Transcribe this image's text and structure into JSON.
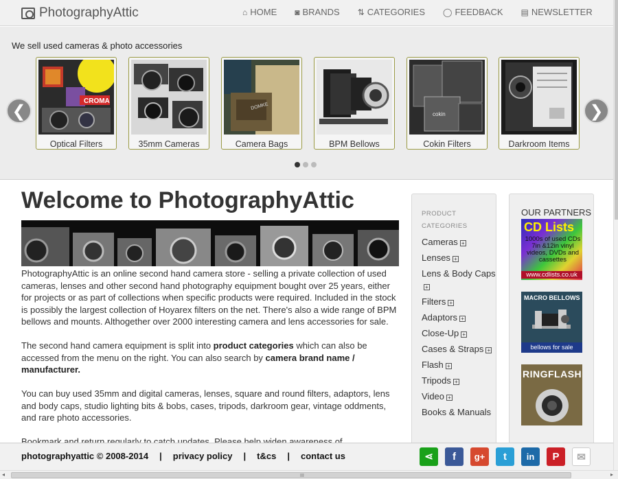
{
  "header": {
    "brand": "PhotographyAttic",
    "nav": [
      {
        "label": "HOME",
        "icon": "home-icon",
        "glyph": "⌂"
      },
      {
        "label": "BRANDS",
        "icon": "camera-icon",
        "glyph": "◙"
      },
      {
        "label": "CATEGORIES",
        "icon": "sort-icon",
        "glyph": "⇅"
      },
      {
        "label": "FEEDBACK",
        "icon": "speech-bubble-icon",
        "glyph": "◯"
      },
      {
        "label": "NEWSLETTER",
        "icon": "newspaper-icon",
        "glyph": "▤"
      }
    ]
  },
  "carousel": {
    "tagline": "We sell used cameras & photo accessories",
    "items": [
      {
        "label": "Optical Filters"
      },
      {
        "label": "35mm Cameras"
      },
      {
        "label": "Camera Bags"
      },
      {
        "label": "BPM Bellows"
      },
      {
        "label": "Cokin Filters"
      },
      {
        "label": "Darkroom Items"
      }
    ],
    "prev_glyph": "❮",
    "next_glyph": "❯",
    "active_slide": 1,
    "slide_count": 3
  },
  "main": {
    "title": "Welcome to PhotographyAttic",
    "p1": "PhotographyAttic is an online second hand camera store - selling a private collection of used cameras, lenses and other second hand photography equipment bought over 25 years, either for projects or as part of collections when specific products were required. Included in the stock is possibly the largest collection of Hoyarex filters on the net. There's also a wide range of BPM bellows and mounts. Althogether over 2000 interesting camera and lens accessories for sale.",
    "p2_a": "The second hand camera equipment is split into ",
    "p2_link1": "product categories",
    "p2_b": " which can also be accessed from the menu on the right. You can also search by ",
    "p2_link2": "camera brand name / manufacturer.",
    "p3": "You can buy used 35mm and digital cameras, lenses, square and round filters, adaptors, lens and body caps, studio lighting bits & bobs, cases, tripods, darkroom gear, vintage oddments, and rare photo accessories.",
    "p4": "Bookmark and return regularly to catch updates. Please help widen awareness of PhotographyAttic by clicking on the share icons at the base of the page to share on your social"
  },
  "categories": {
    "heading": "PRODUCT CATEGORIES",
    "items": [
      {
        "label": "Cameras"
      },
      {
        "label": "Lenses"
      },
      {
        "label": "Lens & Body Caps"
      },
      {
        "label": "Filters"
      },
      {
        "label": "Adaptors"
      },
      {
        "label": "Close-Up"
      },
      {
        "label": "Cases & Straps"
      },
      {
        "label": "Flash"
      },
      {
        "label": "Tripods"
      },
      {
        "label": "Video"
      },
      {
        "label": "Books & Manuals"
      }
    ],
    "expand_glyph": "+"
  },
  "partners": {
    "heading": "OUR PARTNERS",
    "ad1": {
      "title": "CD Lists",
      "body": "1000s of used CDs 7in &12in vinyl videos, DVDs and cassettes",
      "url": "www.cdlists.co.uk"
    },
    "ad2": {
      "title": "MACRO BELLOWS",
      "footer": "bellows for sale"
    },
    "ad3": {
      "title": "RINGFLASH"
    }
  },
  "footer": {
    "copyright": "photographyattic © 2008-2014",
    "privacy": "privacy policy",
    "tcs": "t&cs",
    "contact": "contact us",
    "sep": "|",
    "share": [
      {
        "icon": "share-icon",
        "glyph": "⋖",
        "color": "#1aa11a"
      },
      {
        "icon": "facebook-icon",
        "glyph": "f",
        "color": "#3b5998"
      },
      {
        "icon": "google-plus-icon",
        "glyph": "g+",
        "color": "#d6492f"
      },
      {
        "icon": "twitter-icon",
        "glyph": "t",
        "color": "#2a9fd6"
      },
      {
        "icon": "linkedin-icon",
        "glyph": "in",
        "color": "#1d6aa8"
      },
      {
        "icon": "pinterest-icon",
        "glyph": "P",
        "color": "#cb2027"
      },
      {
        "icon": "email-icon",
        "glyph": "✉",
        "color": "#bbbbbb"
      }
    ]
  },
  "scrollbar": {
    "grip": "III",
    "left": "◂",
    "right": "▸"
  }
}
